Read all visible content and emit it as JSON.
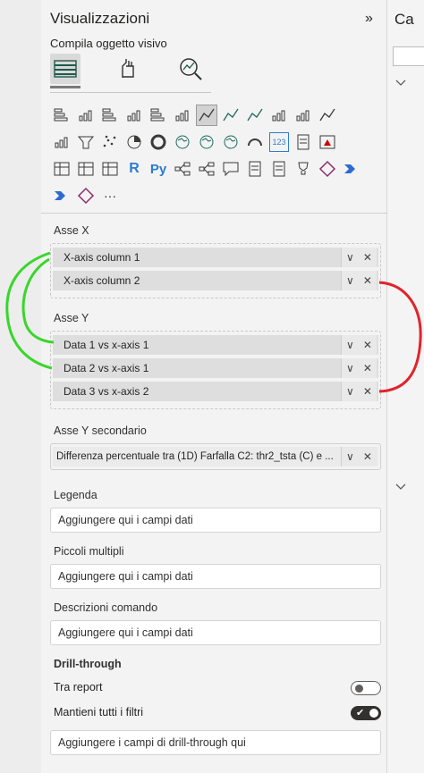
{
  "panel": {
    "title": "Visualizzazioni",
    "subtitle": "Compila oggetto visivo",
    "collapse_glyph": "»",
    "modes": [
      "build-visual-icon",
      "format-visual-icon",
      "analytics-icon"
    ]
  },
  "right_strip": {
    "label": "Ca"
  },
  "visual_icons": [
    "stacked-bar-icon",
    "stacked-column-icon",
    "clustered-bar-icon",
    "clustered-column-icon",
    "100-bar-icon",
    "100-column-icon",
    "line-chart-icon",
    "area-chart-icon",
    "stacked-area-icon",
    "line-stacked-column-icon",
    "line-clustered-column-icon",
    "ribbon-chart-icon",
    "waterfall-icon",
    "funnel-icon",
    "scatter-icon",
    "pie-icon",
    "donut-icon",
    "treemap-icon",
    "map-icon",
    "filled-map-icon",
    "gauge-icon",
    "card-icon",
    "multirow-card-icon",
    "kpi-icon",
    "slicer-icon",
    "table-icon",
    "matrix-icon",
    "r-visual-icon",
    "python-visual-icon",
    "key-influencers-icon",
    "decomposition-tree-icon",
    "qna-icon",
    "smart-narrative-icon",
    "paginated-icon",
    "metrics-icon",
    "power-apps-icon",
    "power-automate-icon",
    "power-automate-alt-icon",
    "get-more-icon",
    "more-icon"
  ],
  "visual_glyphs": {
    "r": "R",
    "py": "Py",
    "card": "123",
    "more": "···"
  },
  "x_axis": {
    "label": "Asse X",
    "fields": [
      "X-axis column 1",
      "X-axis column 2"
    ]
  },
  "y_axis": {
    "label": "Asse Y",
    "fields": [
      "Data 1 vs x-axis 1",
      "Data 2 vs x-axis 1",
      "Data 3 vs x-axis 2"
    ]
  },
  "y2_axis": {
    "label": "Asse Y secondario",
    "field": "Differenza percentuale tra (1D) Farfalla C2: thr2_tsta (C) e ..."
  },
  "legend": {
    "label": "Legenda",
    "placeholder": "Aggiungere qui i campi dati"
  },
  "small_multiples": {
    "label": "Piccoli multipli",
    "placeholder": "Aggiungere qui i campi dati"
  },
  "tooltips": {
    "label": "Descrizioni comando",
    "placeholder": "Aggiungere qui i campi dati"
  },
  "drillthrough": {
    "label": "Drill-through",
    "cross_report": "Tra report",
    "keep_filters": "Mantieni tutti i filtri",
    "placeholder": "Aggiungere i campi di drill-through qui"
  },
  "field_action_glyphs": {
    "expand": "∨",
    "remove": "✕"
  },
  "colors": {
    "green_annotation": "#39d62b",
    "red_annotation": "#e0242c"
  }
}
